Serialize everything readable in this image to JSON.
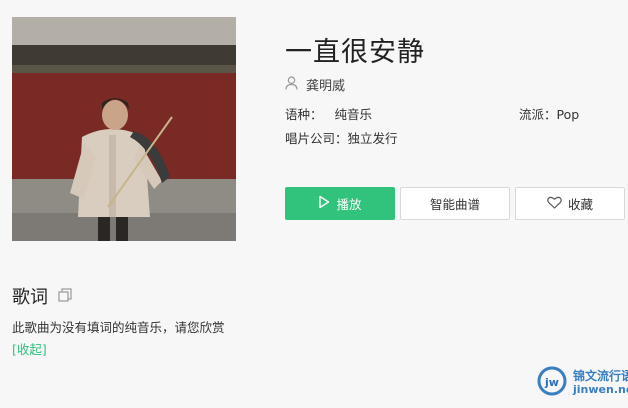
{
  "song": {
    "title": "一直很安静",
    "artist": "龚明威",
    "language_label": "语种：",
    "language_value": "纯音乐",
    "genre_label": "流派：",
    "genre_value": "Pop",
    "label_label": "唱片公司：",
    "label_value": "独立发行"
  },
  "actions": {
    "play_label": "播放",
    "score_label": "智能曲谱",
    "favorite_label": "收藏"
  },
  "lyrics": {
    "heading": "歌词",
    "text": "此歌曲为没有填词的纯音乐，请您欣赏",
    "collapse_label": "[收起]"
  },
  "watermark": {
    "cn": "锦文流行语",
    "url": "jinwen.net"
  },
  "colors": {
    "accent": "#31c27c",
    "background": "#f7f7f7",
    "watermark": "#3a7fc2"
  }
}
